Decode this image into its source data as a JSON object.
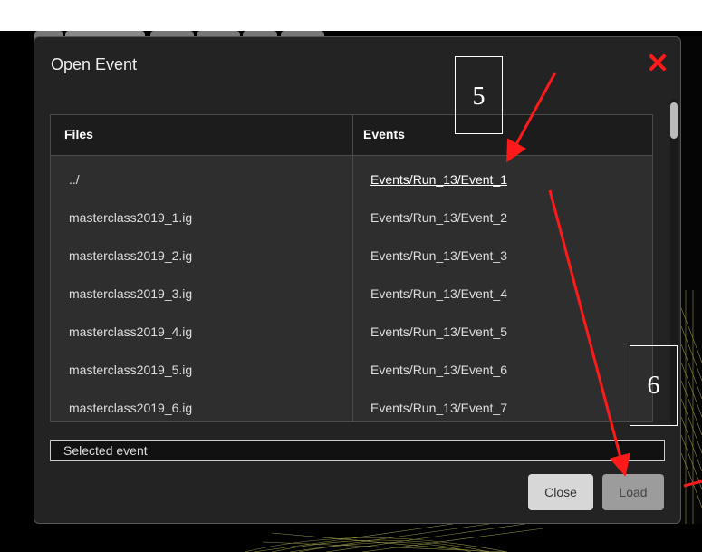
{
  "dialog": {
    "title": "Open Event",
    "close_icon": "close-x-icon"
  },
  "table": {
    "headers": {
      "files": "Files",
      "events": "Events"
    },
    "rows": [
      {
        "file": "../",
        "event": "Events/Run_13/Event_1"
      },
      {
        "file": "masterclass2019_1.ig",
        "event": "Events/Run_13/Event_2"
      },
      {
        "file": "masterclass2019_2.ig",
        "event": "Events/Run_13/Event_3"
      },
      {
        "file": "masterclass2019_3.ig",
        "event": "Events/Run_13/Event_4"
      },
      {
        "file": "masterclass2019_4.ig",
        "event": "Events/Run_13/Event_5"
      },
      {
        "file": "masterclass2019_5.ig",
        "event": "Events/Run_13/Event_6"
      },
      {
        "file": "masterclass2019_6.ig",
        "event": "Events/Run_13/Event_7"
      }
    ],
    "selected_event": "Events/Run_13/Event_1"
  },
  "selected_event_label": "Selected event",
  "buttons": {
    "close": "Close",
    "load": "Load"
  },
  "annotations": {
    "step5": "5",
    "step6": "6"
  },
  "colors": {
    "accent_red": "#ff1a1a",
    "dialog_bg": "#232323"
  }
}
